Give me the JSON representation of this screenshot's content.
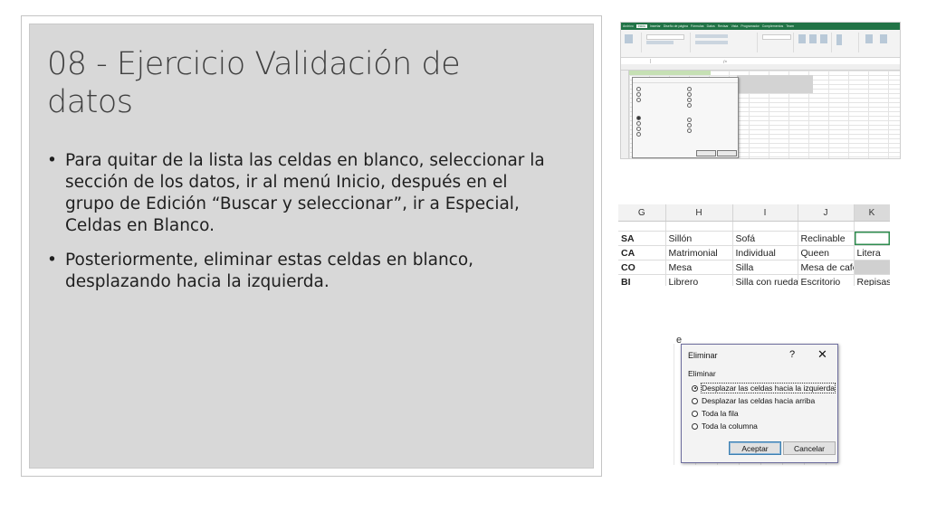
{
  "slide": {
    "title": "08 - Ejercicio Validación de datos",
    "bullets": [
      "Para quitar de la lista las celdas en blanco, seleccionar la sección de los datos, ir al menú Inicio, después en el grupo de Edición “Buscar y seleccionar”, ir a Especial, Celdas en Blanco.",
      "Posteriormente, eliminar estas celdas en blanco, desplazando hacia la izquierda."
    ]
  },
  "excel_thumbnail": {
    "tabs": [
      "Archivo",
      "Inicio",
      "Insertar",
      "Diseño de página",
      "Fórmulas",
      "Datos",
      "Revisar",
      "Vista",
      "Programador",
      "Complementos",
      "Team"
    ]
  },
  "cells": {
    "columns": [
      "G",
      "H",
      "I",
      "J",
      "K"
    ],
    "rows": [
      [
        "SA",
        "Sillón",
        "Sofá",
        "Reclinable",
        ""
      ],
      [
        "CA",
        "Matrimonial",
        "Individual",
        "Queen",
        "Litera"
      ],
      [
        "CO",
        "Mesa",
        "Silla",
        "Mesa de café",
        ""
      ],
      [
        "BI",
        "Librero",
        "Silla con ruedas",
        "Escritorio",
        "Repisas"
      ]
    ]
  },
  "dialog": {
    "background_letter": "e",
    "title": "Eliminar",
    "help": "?",
    "close": "✕",
    "group_label": "Eliminar",
    "options": [
      "Desplazar las celdas hacia la izquierda",
      "Desplazar las celdas hacia arriba",
      "Toda la fila",
      "Toda la columna"
    ],
    "accept": "Aceptar",
    "cancel": "Cancelar"
  },
  "colors": {
    "excel_green": "#217346",
    "panel_gray": "#d8d8d8"
  }
}
